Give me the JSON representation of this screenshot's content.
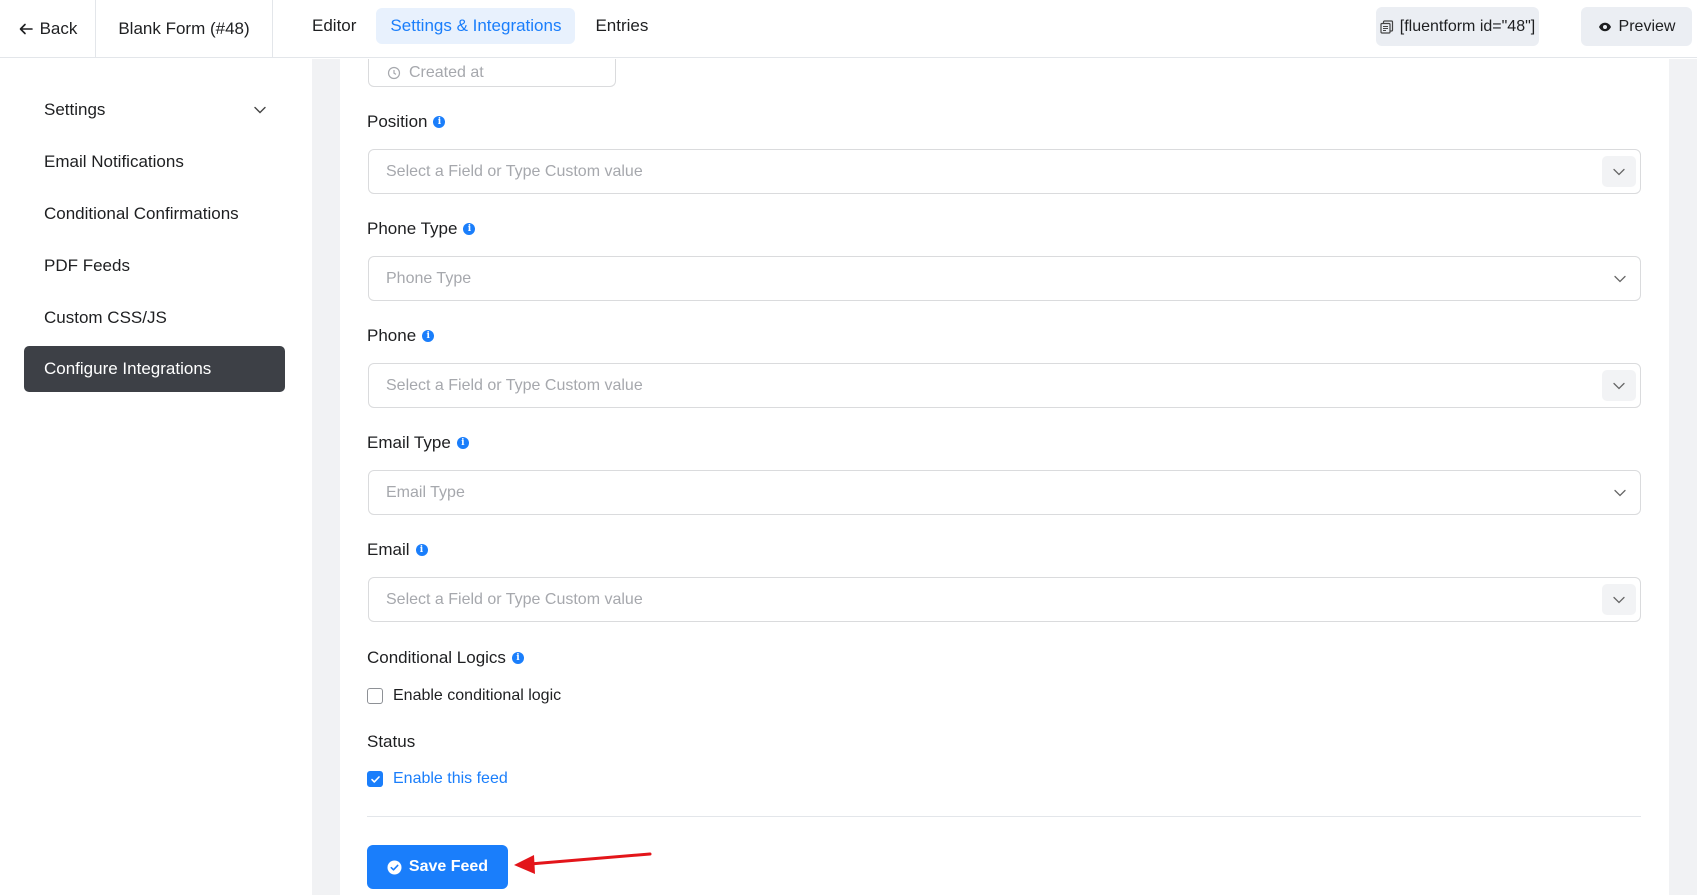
{
  "topbar": {
    "back_label": "Back",
    "form_title": "Blank Form (#48)",
    "tabs": [
      {
        "label": "Editor",
        "active": false
      },
      {
        "label": "Settings & Integrations",
        "active": true
      },
      {
        "label": "Entries",
        "active": false
      }
    ],
    "shortcode_label": "[fluentform id=\"48\"]",
    "preview_label": "Preview"
  },
  "sidebar": {
    "items": [
      {
        "label": "Settings",
        "has_chevron": true,
        "active": false
      },
      {
        "label": "Email Notifications",
        "active": false
      },
      {
        "label": "Conditional Confirmations",
        "active": false
      },
      {
        "label": "PDF Feeds",
        "active": false
      },
      {
        "label": "Custom CSS/JS",
        "active": false
      },
      {
        "label": "Configure Integrations",
        "active": true
      }
    ]
  },
  "form": {
    "created_at_placeholder": "Created at",
    "fields": [
      {
        "label": "Position",
        "placeholder": "Select a Field or Type Custom value"
      },
      {
        "label": "Phone Type",
        "placeholder": "Phone Type"
      },
      {
        "label": "Phone",
        "placeholder": "Select a Field or Type Custom value"
      },
      {
        "label": "Email Type",
        "placeholder": "Email Type"
      },
      {
        "label": "Email",
        "placeholder": "Select a Field or Type Custom value"
      }
    ],
    "conditional": {
      "label": "Conditional Logics",
      "checkbox_label": "Enable conditional logic",
      "checked": false
    },
    "status": {
      "label": "Status",
      "checkbox_label": "Enable this feed",
      "checked": true
    },
    "save_label": "Save Feed"
  },
  "colors": {
    "accent": "#1a7efb",
    "sidebar_active": "#3d4046",
    "annotation_arrow": "#e3151a"
  },
  "icons": {
    "back": "arrow-left-icon",
    "shortcode": "copy-icon",
    "preview": "eye-icon",
    "info": "info-icon",
    "clock": "clock-icon",
    "save": "check-circle-icon"
  }
}
